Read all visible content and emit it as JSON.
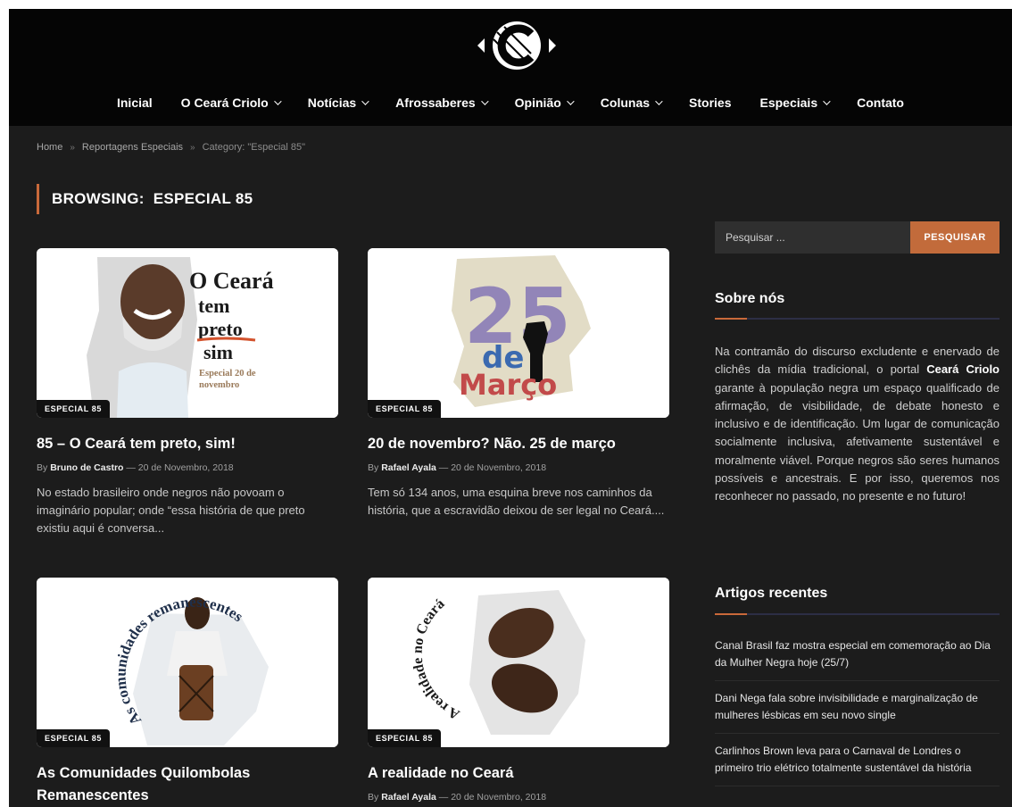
{
  "header": {
    "nav": [
      {
        "label": "Inicial",
        "dropdown": false
      },
      {
        "label": "O Ceará Criolo",
        "dropdown": true
      },
      {
        "label": "Notícias",
        "dropdown": true
      },
      {
        "label": "Afrossaberes",
        "dropdown": true
      },
      {
        "label": "Opinião",
        "dropdown": true
      },
      {
        "label": "Colunas",
        "dropdown": true
      },
      {
        "label": "Stories",
        "dropdown": false
      },
      {
        "label": "Especiais",
        "dropdown": true
      },
      {
        "label": "Contato",
        "dropdown": false
      }
    ]
  },
  "breadcrumb": {
    "home": "Home",
    "section": "Reportagens Especiais",
    "current": "Category: \"Especial 85\"",
    "separator": "»"
  },
  "browsing": {
    "label": "BROWSING:",
    "category": "ESPECIAL 85"
  },
  "posts": [
    {
      "badge": "ESPECIAL 85",
      "title": "85 – O Ceará tem preto, sim!",
      "by": "By",
      "author": "Bruno de Castro",
      "dash": "—",
      "date": "20 de Novembro, 2018",
      "excerpt": "No estado brasileiro onde negros não povoam o imaginário popular; onde “essa história de que preto existiu aqui é conversa...",
      "image_text": {
        "line1": "O Ceará",
        "line2": "tem",
        "line3": "preto",
        "line4": "sim",
        "sub": "Especial 20 de novembro"
      }
    },
    {
      "badge": "ESPECIAL 85",
      "title": "20 de novembro? Não. 25 de março",
      "by": "By",
      "author": "Rafael Ayala",
      "dash": "—",
      "date": "20 de Novembro, 2018",
      "excerpt": "Tem só 134 anos, uma esquina breve nos caminhos da história, que a escravidão deixou de ser legal no Ceará....",
      "image_text": {
        "num": "25",
        "de": "de",
        "month": "Março"
      }
    },
    {
      "badge": "ESPECIAL 85",
      "title": "As Comunidades Quilombolas Remanescentes",
      "image_text": {
        "arc": "As comunidades remanescentes"
      }
    },
    {
      "badge": "ESPECIAL 85",
      "title": "A realidade no Ceará",
      "by": "By",
      "author": "Rafael Ayala",
      "dash": "—",
      "date": "20 de Novembro, 2018",
      "image_text": {
        "arc": "A realidade no Ceará"
      }
    }
  ],
  "sidebar": {
    "search": {
      "placeholder": "Pesquisar ...",
      "button": "PESQUISAR"
    },
    "about": {
      "title": "Sobre nós",
      "text_before": "Na contramão do discurso excludente e enervado de clichês da mídia tradicional, o portal ",
      "brand": "Ceará Criolo",
      "text_after": " garante à população negra um espaço qualificado de afirmação, de visibilidade, de debate honesto e inclusivo e de identificação. Um lugar de comunicação socialmente inclusiva, afetivamente sustentável e moralmente viável. Porque negros são seres humanos possíveis e ancestrais. E por isso, queremos nos reconhecer no passado, no presente e no futuro!"
    },
    "recent": {
      "title": "Artigos recentes",
      "items": [
        "Canal Brasil faz mostra especial em comemoração ao Dia da Mulher Negra hoje (25/7)",
        "Dani Nega fala sobre invisibilidade e marginalização de mulheres lésbicas em seu novo single",
        "Carlinhos Brown leva para o Carnaval de Londres o primeiro trio elétrico totalmente sustentável da história"
      ]
    }
  },
  "colors": {
    "accent": "#c9693a",
    "background": "#1c1c1c",
    "header": "#050505",
    "button": "#c26b3b"
  }
}
